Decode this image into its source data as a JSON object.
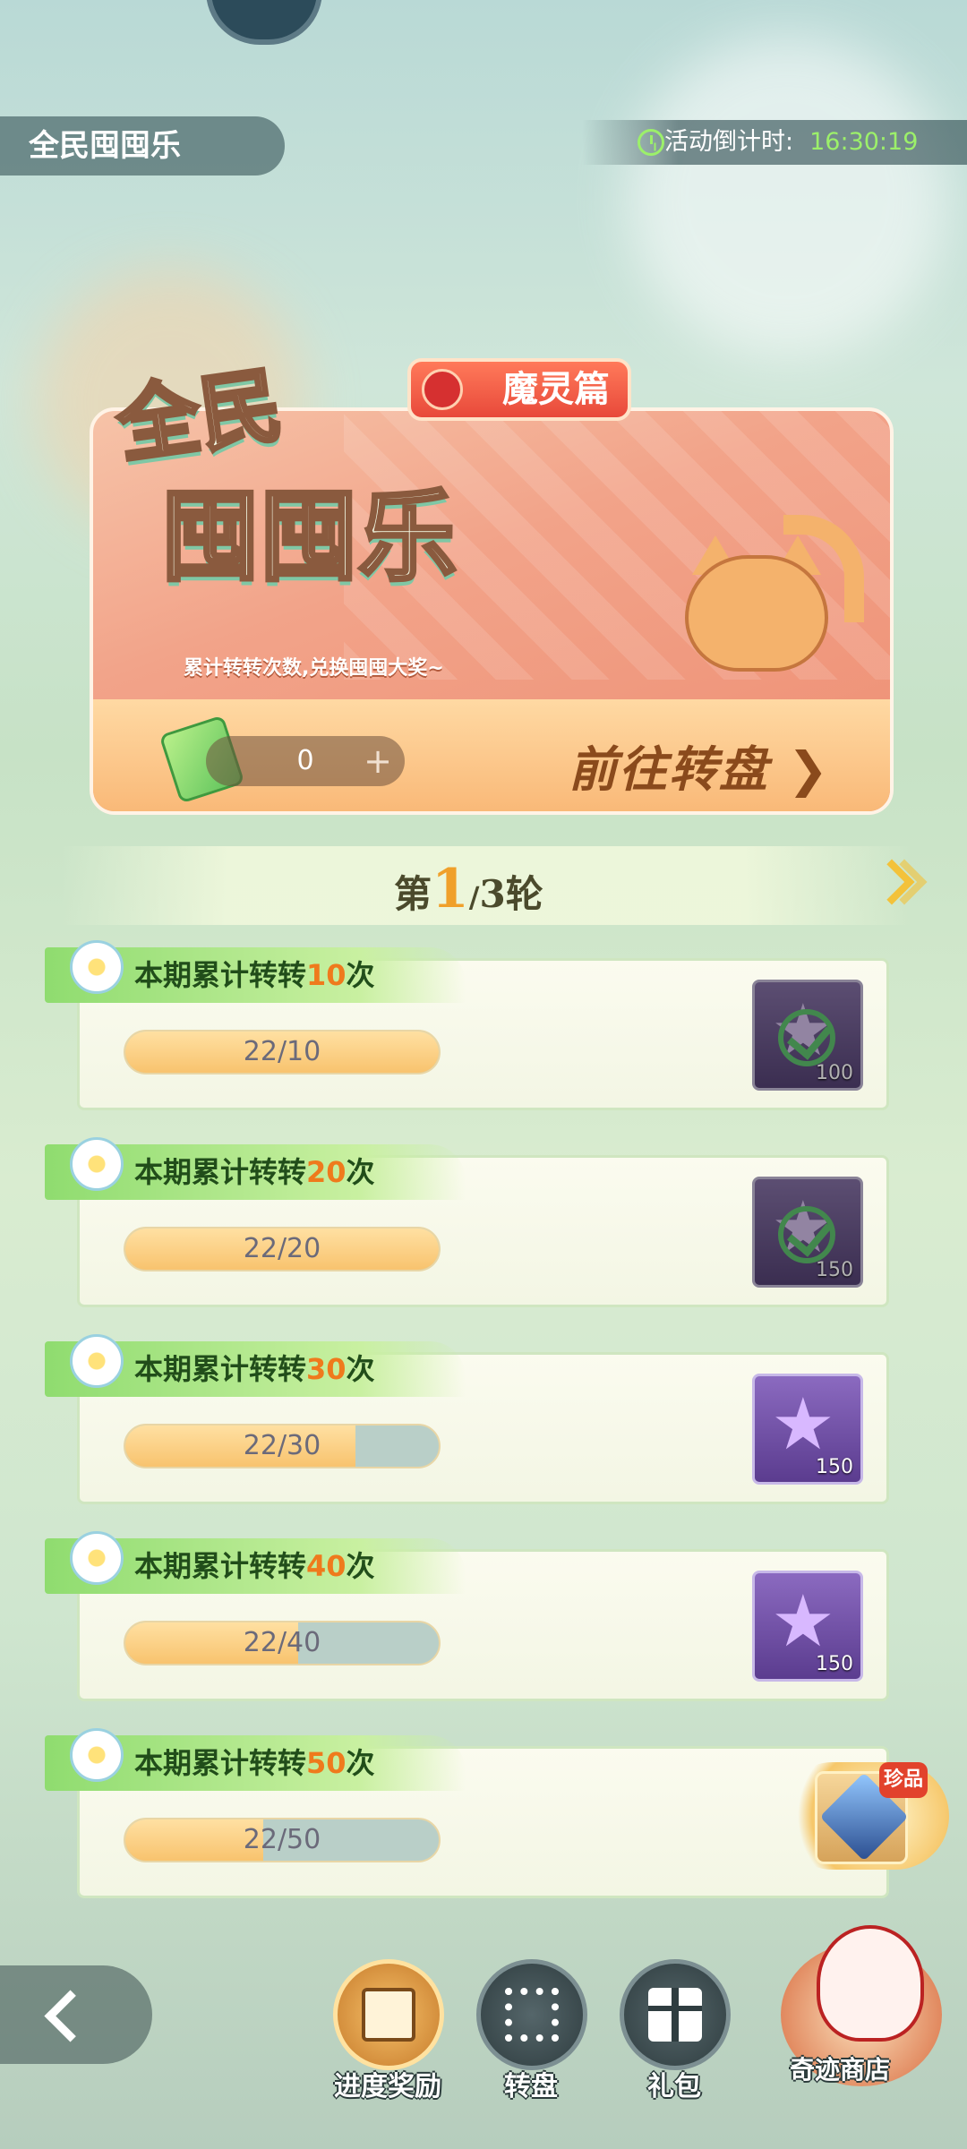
{
  "header": {
    "title": "全民囤囤乐",
    "timer_label": "活动倒计时:",
    "timer_value": "16:30:19"
  },
  "banner": {
    "tag": "魔灵篇",
    "title_line1": "全民",
    "title_line2": "囤囤乐",
    "subtitle": "累计转转次数,兑换囤囤大奖~",
    "ticket_count": "0",
    "plus": "+",
    "goto_label": "前往转盘 ❯"
  },
  "round": {
    "prefix": "第",
    "current": "1",
    "separator": "/",
    "total": "3",
    "suffix": "轮"
  },
  "tasks": [
    {
      "label_pre": "本期累计转转",
      "num": "10",
      "label_post": "次",
      "progress_text": "22/10",
      "progress": 1.0,
      "reward_count": "100",
      "claimed": true
    },
    {
      "label_pre": "本期累计转转",
      "num": "20",
      "label_post": "次",
      "progress_text": "22/20",
      "progress": 1.0,
      "reward_count": "150",
      "claimed": true
    },
    {
      "label_pre": "本期累计转转",
      "num": "30",
      "label_post": "次",
      "progress_text": "22/30",
      "progress": 0.733,
      "reward_count": "150",
      "claimed": false
    },
    {
      "label_pre": "本期累计转转",
      "num": "40",
      "label_post": "次",
      "progress_text": "22/40",
      "progress": 0.55,
      "reward_count": "150",
      "claimed": false
    },
    {
      "label_pre": "本期累计转转",
      "num": "50",
      "label_post": "次",
      "progress_text": "22/50",
      "progress": 0.44,
      "reward_count": "",
      "claimed": false
    }
  ],
  "treasure_badge": "珍品",
  "nav": {
    "progress_reward": "进度奖励",
    "wheel": "转盘",
    "gift": "礼包",
    "shop": "奇迹商店"
  },
  "colors": {
    "accent_orange": "#ef7a1c",
    "timer_green": "#9cf06a",
    "label_green": "#8fdc6f"
  }
}
